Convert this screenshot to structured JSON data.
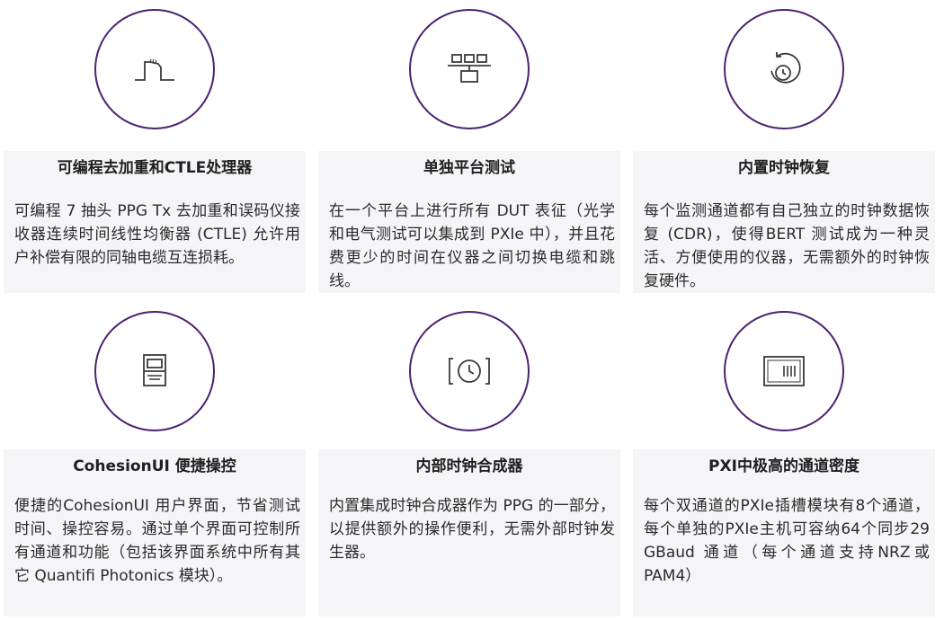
{
  "features": [
    {
      "icon": "waveform-pulse-icon",
      "title": "可编程去加重和CTLE处理器",
      "description": "可编程 7 抽头 PPG Tx 去加重和误码仪接收器连续时间线性均衡器 (CTLE) 允许用户补偿有限的同轴电缆互连损耗。"
    },
    {
      "icon": "network-modules-icon",
      "title": "单独平台测试",
      "description": "在一个平台上进行所有 DUT 表征（光学和电气测试可以集成到 PXIe 中），并且花费更少的时间在仪器之间切换电缆和跳线。"
    },
    {
      "icon": "clock-recovery-icon",
      "title": "内置时钟恢复",
      "description": "每个监测通道都有自己独立的时钟数据恢复 (CDR)，使得BERT 测试成为一种灵活、方便使用的仪器，无需额外的时钟恢复硬件。"
    },
    {
      "icon": "instrument-panel-icon",
      "title": "CohesionUI 便捷操控",
      "description": "便捷的CohesionUI 用户界面，节省测试时间、操控容易。通过单个界面可控制所有通道和功能（包括该界面系统中所有其它 Quantifi Photonics 模块）。"
    },
    {
      "icon": "clock-synthesizer-icon",
      "title": "内部时钟合成器",
      "description": "内置集成时钟合成器作为 PPG 的一部分，以提供额外的操作便利，无需外部时钟发生器。"
    },
    {
      "icon": "channel-density-icon",
      "title": "PXI中极高的通道密度",
      "description": "每个双通道的PXIe插槽模块有8个通道，每个单独的PXIe主机可容纳64个同步29 GBaud 通道（每个通道支持NRZ或PAM4）"
    }
  ],
  "colors": {
    "accent": "#4b2170",
    "panel": "#f5f4f7"
  }
}
